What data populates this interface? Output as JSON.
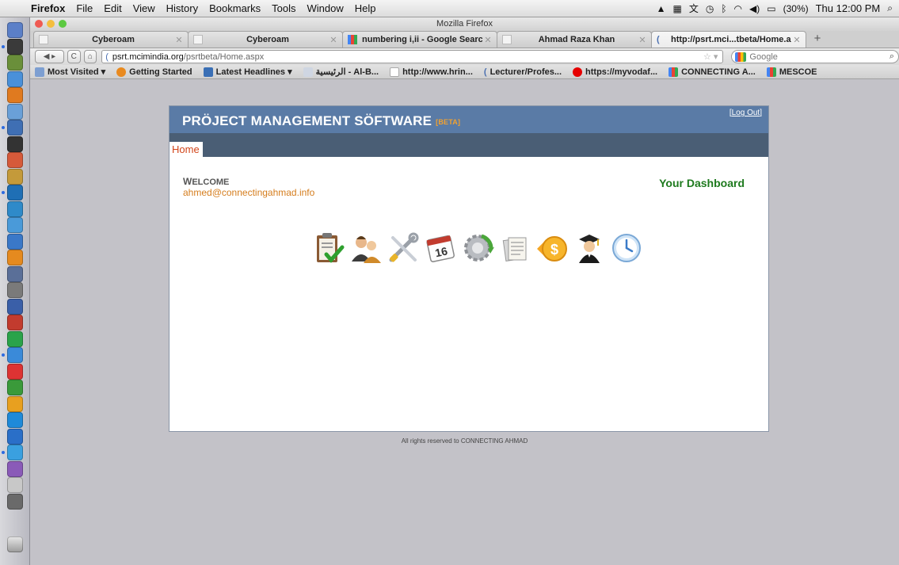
{
  "menubar": {
    "apple": "",
    "items": [
      "Firefox",
      "File",
      "Edit",
      "View",
      "History",
      "Bookmarks",
      "Tools",
      "Window",
      "Help"
    ],
    "battery": "(30%)",
    "clock": "Thu 12:00 PM"
  },
  "window": {
    "title": "Mozilla Firefox"
  },
  "tabs": [
    {
      "label": "Cyberoam"
    },
    {
      "label": "Cyberoam"
    },
    {
      "label": "numbering i,ii - Google Search"
    },
    {
      "label": "Ahmad Raza Khan"
    },
    {
      "label": "http://psrt.mci...tbeta/Home.aspx"
    }
  ],
  "navbar": {
    "url_host": "psrt.mcimindia.org",
    "url_path": "/psrtbeta/Home.aspx",
    "search_placeholder": "Google"
  },
  "bookmarks": [
    "Most Visited ▾",
    "Getting Started",
    "Latest Headlines ▾",
    "الرئيسية - Al-B...",
    "http://www.hrin...",
    "Lecturer/Profes...",
    "https://myvodaf...",
    "CONNECTING A...",
    "MESCOE"
  ],
  "app": {
    "title_main": "PRÖJECT MANAGEMENT SÖFTWARE",
    "title_beta": "[BETA]",
    "logout_open": "[",
    "logout_label": "Log Out",
    "logout_close": "]",
    "nav_home": "Home",
    "welcome_first": "W",
    "welcome_rest": "ELCOME",
    "user_email": "ahmed@connectingahmad.info",
    "dashboard_title": "Your Dashboard",
    "modules": [
      "clipboard-check",
      "users",
      "tools",
      "calendar-16",
      "gear-refresh",
      "documents",
      "money-dollar",
      "graduate",
      "clock"
    ]
  },
  "footer": {
    "text": "All rights reserved to CONNECTING AHMAD"
  }
}
